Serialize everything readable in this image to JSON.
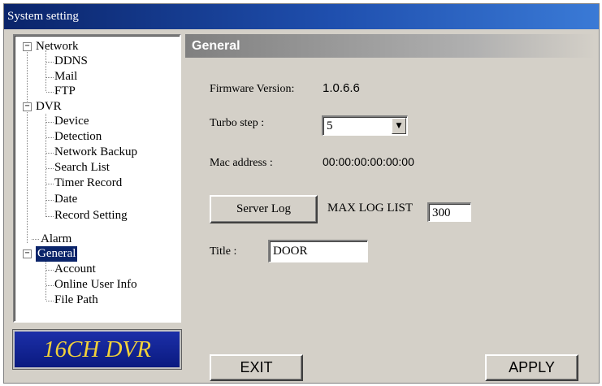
{
  "window": {
    "title": "System setting"
  },
  "tree": {
    "network": {
      "label": "Network",
      "children": [
        "DDNS",
        "Mail",
        "FTP"
      ]
    },
    "dvr": {
      "label": "DVR",
      "children": [
        "Device",
        "Detection",
        "Network Backup",
        "Search List",
        "Timer Record",
        "Date",
        "Record Setting"
      ]
    },
    "alarm": {
      "label": "Alarm"
    },
    "general": {
      "label": "General",
      "children": [
        "Account",
        "Online User Info",
        "File Path"
      ]
    },
    "expander_symbol": "−"
  },
  "logo": {
    "text": "16CH DVR",
    "text_color": "#f2d23a",
    "bg_color": "#0a1a80"
  },
  "panel": {
    "header": "General",
    "firmware_label": "Firmware Version:",
    "firmware_value": "1.0.6.6",
    "turbo_label": "Turbo step :",
    "turbo_value": "5",
    "mac_label": "Mac address :",
    "mac_value": "00:00:00:00:00:00",
    "server_log_button": "Server Log",
    "max_log_label": "MAX LOG LIST",
    "max_log_value": "300",
    "title_label": "Title :",
    "title_value": "DOOR",
    "dropdown_arrow": "▼"
  },
  "footer": {
    "exit_label": "EXIT",
    "apply_label": "APPLY"
  },
  "colors": {
    "titlebar": "#0a246a",
    "selection": "#0a246a",
    "face": "#d4d0c8"
  }
}
